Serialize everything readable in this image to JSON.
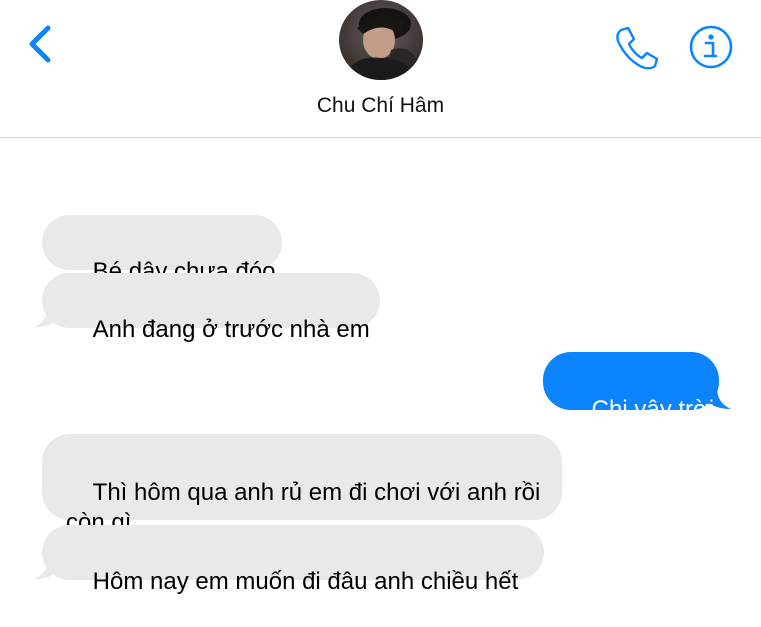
{
  "header": {
    "contact_name": "Chu Chí Hâm",
    "back_icon": "chevron-left-icon",
    "phone_icon": "phone-icon",
    "info_icon": "info-icon"
  },
  "colors": {
    "accent": "#0b84fe",
    "incoming_bubble": "#e9e9eb",
    "divider": "#d8d8dc"
  },
  "messages": [
    {
      "direction": "incoming",
      "text": "Bé dậy chưa đóo"
    },
    {
      "direction": "incoming",
      "text": "Anh đang ở trước nhà em"
    },
    {
      "direction": "outgoing",
      "text": "Chi vậy trời"
    },
    {
      "direction": "incoming",
      "text": "Thì hôm qua anh rủ em đi chơi với anh rồi còn gì"
    },
    {
      "direction": "incoming",
      "text": "Hôm nay em muốn đi đâu anh chiều hết"
    }
  ]
}
